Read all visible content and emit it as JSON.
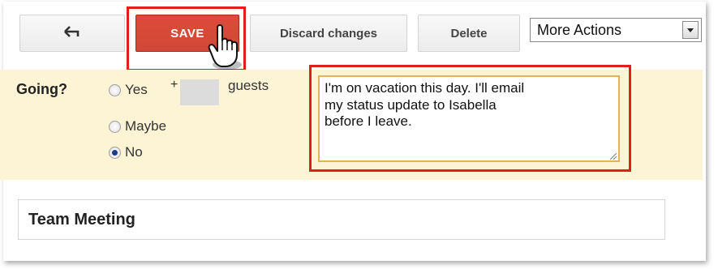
{
  "toolbar": {
    "back_icon": "back-arrow-icon",
    "save_label": "SAVE",
    "discard_label": "Discard changes",
    "delete_label": "Delete",
    "more_actions": {
      "selected": "More Actions"
    }
  },
  "rsvp": {
    "going_label": "Going?",
    "options": [
      {
        "label": "Yes",
        "checked": false
      },
      {
        "label": "Maybe",
        "checked": false
      },
      {
        "label": "No",
        "checked": true
      }
    ],
    "plus": "+",
    "guests_label": "guests",
    "note_text": "I'm on vacation this day. I'll email\nmy status update to Isabella\nbefore I leave."
  },
  "event": {
    "title": "Team Meeting"
  },
  "colors": {
    "save_button": "#d14836",
    "highlight": "#e31d1d",
    "rsvp_band": "#fdf4d6",
    "note_border": "#e3b35a"
  }
}
